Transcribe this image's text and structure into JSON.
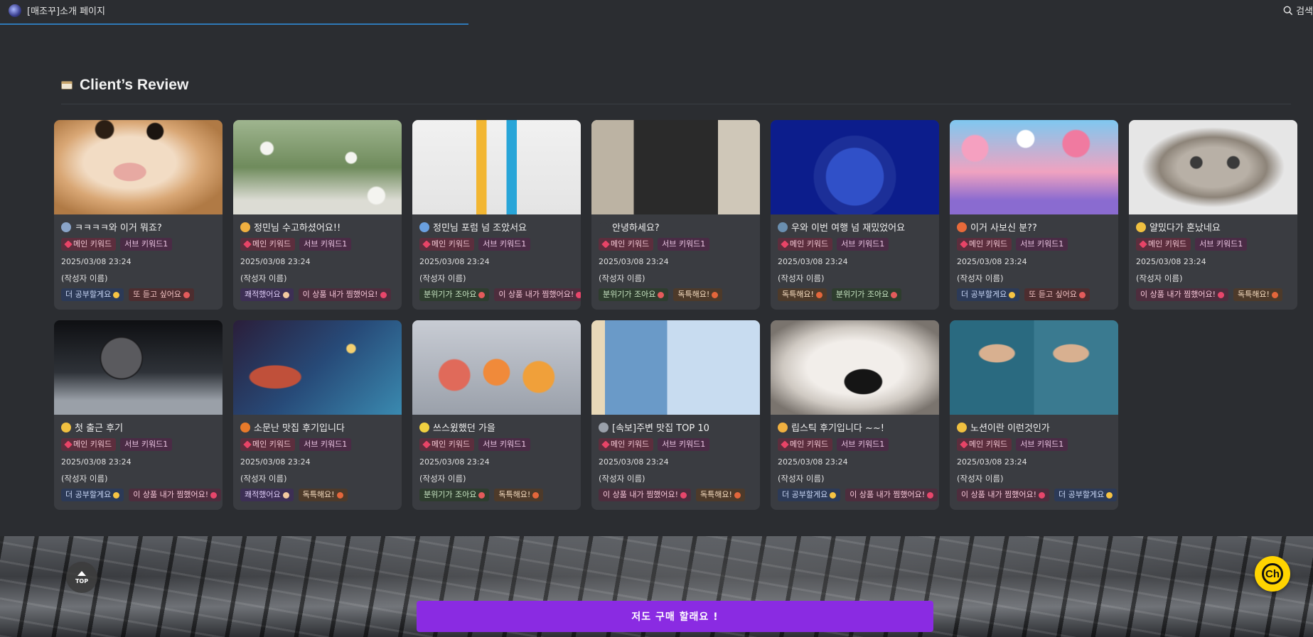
{
  "header": {
    "title": "[매조꾸]소개 페이지",
    "search_label": "검색"
  },
  "section": {
    "title": "Client’s Review"
  },
  "cards": [
    {
      "title": "ㅋㅋㅋㅋ와 이거 뭐죠?",
      "emoji_color": "#8aa4c8",
      "main_tag": "메인 키워드",
      "sub_tag": "서브 키워드1",
      "date": "2025/03/08 23:24",
      "author": "(작성자 이름)",
      "chips": [
        {
          "label": "더 공부할게요",
          "bg": "#2c3a57",
          "fg": "#c9d7f5",
          "dot": "#f6c343"
        },
        {
          "label": "또 듣고 싶어요",
          "bg": "#4d2d2f",
          "fg": "#f3c4c4",
          "dot": "#e35b5b"
        }
      ],
      "thumb": "radial-gradient(circle at 30% 10%, #2b1e14 0 6%, transparent 7%), radial-gradient(circle at 60% 12%, #1b1410 0 6%, transparent 7%), radial-gradient(ellipse at 45% 55%, #e7a9a2 0 12%, transparent 13%), radial-gradient(ellipse at 45% 45%, #f2dcc4 0 35%, #d9a775 55%, #b07a45 80%)"
    },
    {
      "title": "정민님 수고하셨어요!!",
      "emoji_color": "#f0b040",
      "main_tag": "메인 키워드",
      "sub_tag": "서브 키워드1",
      "date": "2025/03/08 23:24",
      "author": "(작성자 이름)",
      "chips": [
        {
          "label": "쾌적했어요",
          "bg": "#3d2f55",
          "fg": "#dccbf5",
          "dot": "#f2c9a0"
        },
        {
          "label": "이 상품 내가 찜했어요!",
          "bg": "#4d2d3d",
          "fg": "#f5c7d8",
          "dot": "#e8466b"
        }
      ],
      "thumb": "radial-gradient(circle at 20% 30%, #f4f4f0 0 4%, transparent 5%), radial-gradient(circle at 70% 40%, #f4f4f0 0 4%, transparent 5%), radial-gradient(circle at 85% 80%, #f4f4f0 0 5%, transparent 6%), linear-gradient(180deg, #9fb58f, #6f8b5c 50%, #dcdcd4 85%)"
    },
    {
      "title": "정민님 포럼 넘 조았서요",
      "emoji_color": "#6aa0e0",
      "main_tag": "메인 키워드",
      "sub_tag": "서브 키워드1",
      "date": "2025/03/08 23:24",
      "author": "(작성자 이름)",
      "chips": [
        {
          "label": "분위기가 조아요",
          "bg": "#2e3d2e",
          "fg": "#c9e6c4",
          "dot": "#e35b5b"
        },
        {
          "label": "이 상품 내가 찜했어요!",
          "bg": "#4d2d3d",
          "fg": "#f5c7d8",
          "dot": "#e8466b"
        }
      ],
      "thumb": "linear-gradient(90deg, transparent 38%, #f2b632 38% 44%, transparent 44% 56%, #28a5d8 56% 62%, transparent 62%), linear-gradient(180deg, #f1f1f1, #e4e4e4)"
    },
    {
      "title": "안녕하세요?",
      "emoji_color": "#3a3c41",
      "main_tag": "메인 키워드",
      "sub_tag": "서브 키워드1",
      "date": "2025/03/08 23:24",
      "author": "(작성자 이름)",
      "chips": [
        {
          "label": "분위기가 조아요",
          "bg": "#2e3d2e",
          "fg": "#c9e6c4",
          "dot": "#e35b5b"
        },
        {
          "label": "독특해요!",
          "bg": "#4d3a2a",
          "fg": "#f5dcc0",
          "dot": "#e3663b"
        }
      ],
      "thumb": "linear-gradient(90deg, #bcb3a3 0 25%, #2a2a2a 25% 75%, #cfc7b8 75%), linear-gradient(180deg, #d7d0c2, #8a8377)"
    },
    {
      "title": "우와 이번 여행 넘 재밌었어요",
      "emoji_color": "#6a8fb0",
      "main_tag": "메인 키워드",
      "sub_tag": "서브 키워드1",
      "date": "2025/03/08 23:24",
      "author": "(작성자 이름)",
      "chips": [
        {
          "label": "독특해요!",
          "bg": "#4d3a2a",
          "fg": "#f5dcc0",
          "dot": "#e3663b"
        },
        {
          "label": "분위기가 조아요",
          "bg": "#2e3d2e",
          "fg": "#c9e6c4",
          "dot": "#e35b5b"
        }
      ],
      "thumb": "radial-gradient(circle at 50% 60%, #3050c8 0 28%, #1c2f98 29% 40%, #0c1d8c 41%)"
    },
    {
      "title": "이거 사보신 분??",
      "emoji_color": "#e86a3a",
      "main_tag": "메인 키워드",
      "sub_tag": "서브 키워드1",
      "date": "2025/03/08 23:24",
      "author": "(작성자 이름)",
      "chips": [
        {
          "label": "더 공부할게요",
          "bg": "#2c3a57",
          "fg": "#c9d7f5",
          "dot": "#f6c343"
        },
        {
          "label": "또 듣고 싶어요",
          "bg": "#4d2d2f",
          "fg": "#f3c4c4",
          "dot": "#e35b5b"
        }
      ],
      "thumb": "radial-gradient(circle at 15% 30%, #f5a0c0 0 8%, transparent 9%), radial-gradient(circle at 75% 25%, #f07aa0 0 9%, transparent 10%), radial-gradient(circle at 45% 20%, #ffffff 0 7%, transparent 8%), linear-gradient(180deg, #7fc8f0, #f0a2c0 55%, #8a6bd0 85%)"
    },
    {
      "title": "얄밌다가 혼났네요",
      "emoji_color": "#f0c040",
      "main_tag": "메인 키워드",
      "sub_tag": "서브 키워드1",
      "date": "2025/03/08 23:24",
      "author": "(작성자 이름)",
      "chips": [
        {
          "label": "이 상품 내가 찜했어요!",
          "bg": "#4d2d3d",
          "fg": "#f5c7d8",
          "dot": "#e8466b"
        },
        {
          "label": "독특해요!",
          "bg": "#4d3a2a",
          "fg": "#f5dcc0",
          "dot": "#e3663b"
        }
      ],
      "thumb": "radial-gradient(circle at 40% 45%, #3a3a3a 0 5%, transparent 6%), radial-gradient(circle at 62% 45%, #3a3a3a 0 5%, transparent 6%), radial-gradient(ellipse at 50% 50%, #b8b0a6 0 30%, #8d8479 45%, #e6e6e6 60%)"
    },
    {
      "title": "첫 출근 후기",
      "emoji_color": "#f0c040",
      "main_tag": "메인 키워드",
      "sub_tag": "서브 키워드1",
      "date": "2025/03/08 23:24",
      "author": "(작성자 이름)",
      "chips": [
        {
          "label": "더 공부할게요",
          "bg": "#2c3a57",
          "fg": "#c9d7f5",
          "dot": "#f6c343"
        },
        {
          "label": "이 상품 내가 찜했어요!",
          "bg": "#4d2d3d",
          "fg": "#f5c7d8",
          "dot": "#e8466b"
        }
      ],
      "thumb": "radial-gradient(circle at 40% 40%, #5a5a5e 0 17%, #1a1a1c 18%, transparent 19%), linear-gradient(180deg, #0e0f12, #2e3238 55%, #9aa0a8 85%)"
    },
    {
      "title": "소문난 맛집 후기입니다",
      "emoji_color": "#e87a2a",
      "main_tag": "메인 키워드",
      "sub_tag": "서브 키워드1",
      "date": "2025/03/08 23:24",
      "author": "(작성자 이름)",
      "chips": [
        {
          "label": "쾌적했어요",
          "bg": "#3d2f55",
          "fg": "#dccbf5",
          "dot": "#f2c9a0"
        },
        {
          "label": "독특해요!",
          "bg": "#4d3a2a",
          "fg": "#f5dcc0",
          "dot": "#e3663b"
        }
      ],
      "thumb": "radial-gradient(ellipse at 25% 60%, #c0503a 0 14%, transparent 15%), radial-gradient(circle at 70% 30%, #f4d070 0 3%, transparent 4%), linear-gradient(135deg, #2a1e3a, #274a78 50%, #3a8ab0)"
    },
    {
      "title": "쓰스윘했던 가을",
      "emoji_color": "#f0d040",
      "main_tag": "메인 키워드",
      "sub_tag": "서브 키워드1",
      "date": "2025/03/08 23:24",
      "author": "(작성자 이름)",
      "chips": [
        {
          "label": "분위기가 조아요",
          "bg": "#2e3d2e",
          "fg": "#c9e6c4",
          "dot": "#e35b5b"
        },
        {
          "label": "독특해요!",
          "bg": "#4d3a2a",
          "fg": "#f5dcc0",
          "dot": "#e3663b"
        }
      ],
      "thumb": "radial-gradient(circle at 25% 58%, #e06a5a 0 11%, transparent 12%), radial-gradient(circle at 50% 55%, #f08a3a 0 13%, transparent 14%), radial-gradient(circle at 75% 60%, #f0a03a 0 11%, transparent 12%), linear-gradient(180deg, #c8ccd4, #9aa0aa)"
    },
    {
      "title": "[속보]주변 맛집 TOP 10",
      "emoji_color": "#9aa0aa",
      "main_tag": "메인 키워드",
      "sub_tag": "서브 키워드1",
      "date": "2025/03/08 23:24",
      "author": "(작성자 이름)",
      "chips": [
        {
          "label": "이 상품 내가 찜했어요!",
          "bg": "#4d2d3d",
          "fg": "#f5c7d8",
          "dot": "#e8466b"
        },
        {
          "label": "독특해요!",
          "bg": "#4d3a2a",
          "fg": "#f5dcc0",
          "dot": "#e3663b"
        }
      ],
      "thumb": "linear-gradient(90deg, #e8d8b8 0 8%, #6a9ac8 8% 45%, #c8dcf0 45%)"
    },
    {
      "title": "립스틱 후기입니다 ~~!",
      "emoji_color": "#f0b040",
      "main_tag": "메인 키워드",
      "sub_tag": "서브 키워드1",
      "date": "2025/03/08 23:24",
      "author": "(작성자 이름)",
      "chips": [
        {
          "label": "더 공부할게요",
          "bg": "#2c3a57",
          "fg": "#c9d7f5",
          "dot": "#f6c343"
        },
        {
          "label": "이 상품 내가 찜했어요!",
          "bg": "#4d2d3d",
          "fg": "#f5c7d8",
          "dot": "#e8466b"
        }
      ],
      "thumb": "radial-gradient(ellipse at 55% 65%, #151515 0 14%, transparent 15%), radial-gradient(ellipse at 50% 50%, #f2eeea 0 40%, #cfc9c2 60%, #7a746e 85%)"
    },
    {
      "title": "노션이란 이런것인가",
      "emoji_color": "#f0c040",
      "main_tag": "메인 키워드",
      "sub_tag": "서브 키워드1",
      "date": "2025/03/08 23:24",
      "author": "(작성자 이름)",
      "chips": [
        {
          "label": "이 상품 내가 찜했어요!",
          "bg": "#4d2d3d",
          "fg": "#f5c7d8",
          "dot": "#e8466b"
        },
        {
          "label": "더 공부할게요",
          "bg": "#2c3a57",
          "fg": "#c9d7f5",
          "dot": "#f6c343"
        }
      ],
      "thumb": "radial-gradient(ellipse at 28% 35%, #d8b090 0 10%, transparent 11%), radial-gradient(ellipse at 72% 35%, #d8b090 0 10%, transparent 11%), linear-gradient(90deg, #2a6a80 0 50%, #3a7a90 50%)"
    }
  ],
  "footer": {
    "top_label": "TOP",
    "chat_label": "Ch",
    "buy_label": "저도 구매 할래요 !"
  }
}
